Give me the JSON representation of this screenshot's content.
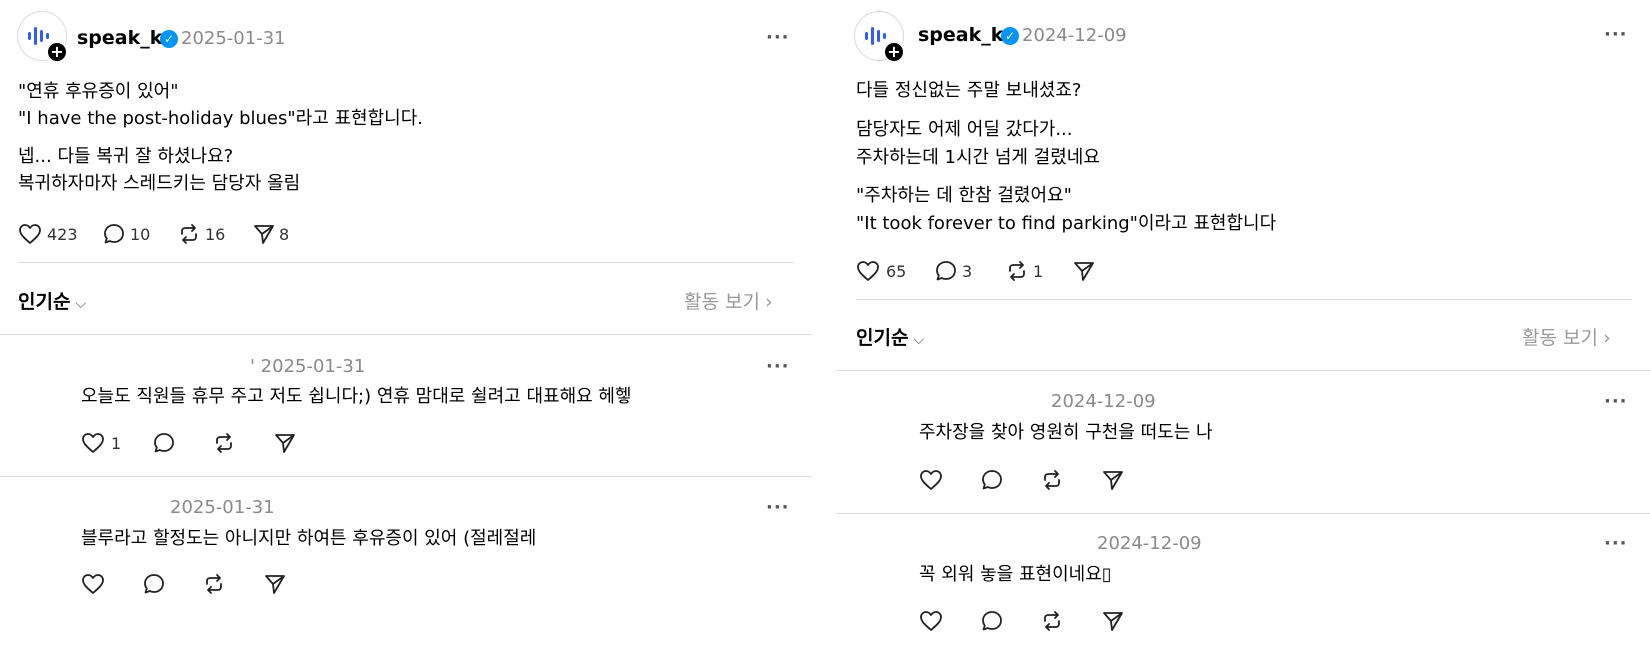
{
  "left": {
    "post": {
      "author": "speak_kr",
      "date": "2025-01-31",
      "more": "···",
      "lines": [
        "\"연휴 후유증이 있어\"",
        "\"I have the post-holiday blues\"라고 표현합니다.",
        "넵... 다들 복귀 잘 하셨나요?",
        "복귀하자마자 스레드키는 담당자 올림"
      ],
      "likes": "423",
      "comments": "10",
      "reposts": "16",
      "shares": "8"
    },
    "sort_label": "인기순",
    "activity_label": "활동 보기",
    "replies": [
      {
        "date": "' 2025-01-31",
        "text": "오늘도 직원들 휴무 주고 저도 쉽니다;) 연휴 맘대로 쉴려고 대표해요 헤헿",
        "likes": "1"
      },
      {
        "date": "2025-01-31",
        "text": "블루라고 할정도는 아니지만 하여튼 후유증이 있어 (절레절레",
        "likes": ""
      }
    ]
  },
  "right": {
    "post": {
      "author": "speak_kr",
      "date": "2024-12-09",
      "more": "···",
      "lines": [
        "다들 정신없는 주말 보내셨죠?",
        "담당자도 어제 어딜 갔다가...",
        "주차하는데 1시간 넘게 걸렸네요",
        "\"주차하는 데 한참 걸렸어요\"",
        "\"It took forever to find parking\"이라고 표현합니다"
      ],
      "likes": "65",
      "comments": "3",
      "reposts": "1",
      "shares": ""
    },
    "sort_label": "인기순",
    "activity_label": "활동 보기",
    "replies": [
      {
        "date": "2024-12-09",
        "text": "주차장을 찾아 영원히 구천을 떠도는 나",
        "likes": ""
      },
      {
        "date": "2024-12-09",
        "text": "꼭 외워 놓을 표현이네요▯",
        "likes": ""
      }
    ]
  },
  "icons": {
    "heart": "heart-icon",
    "comment": "comment-icon",
    "repost": "repost-icon",
    "share": "share-icon",
    "verified": "verified-badge-icon",
    "chevron": "chevron-right-icon",
    "caret": "chevron-down-icon"
  },
  "colors": {
    "logo_blue": "#2f5bff",
    "verified_blue": "#0095f6",
    "muted": "#8a8a8a"
  }
}
